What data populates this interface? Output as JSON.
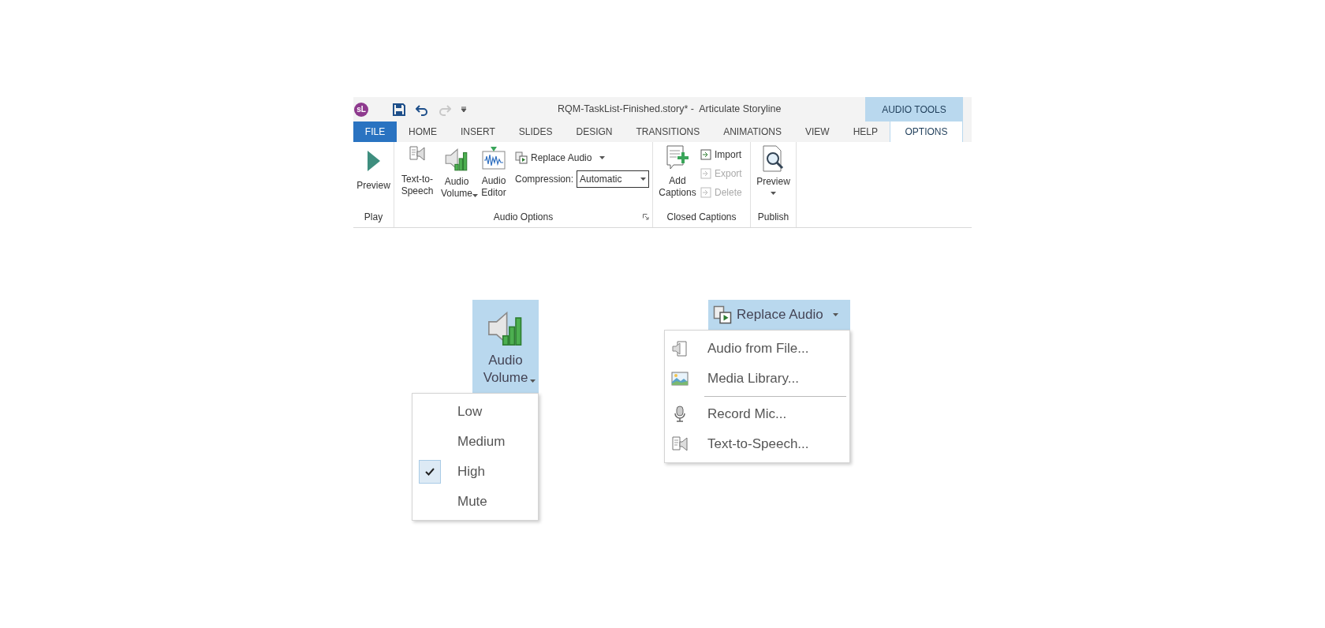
{
  "app_icon": "sL",
  "window_title": "RQM-TaskList-Finished.story* -  Articulate Storyline",
  "contextual_group": "AUDIO TOOLS",
  "tabs": [
    {
      "label": "FILE",
      "kind": "file",
      "selected": false
    },
    {
      "label": "HOME",
      "kind": "plain",
      "selected": false
    },
    {
      "label": "INSERT",
      "kind": "plain",
      "selected": false
    },
    {
      "label": "SLIDES",
      "kind": "plain",
      "selected": false
    },
    {
      "label": "DESIGN",
      "kind": "plain",
      "selected": false
    },
    {
      "label": "TRANSITIONS",
      "kind": "plain",
      "selected": false
    },
    {
      "label": "ANIMATIONS",
      "kind": "plain",
      "selected": false
    },
    {
      "label": "VIEW",
      "kind": "plain",
      "selected": false
    },
    {
      "label": "HELP",
      "kind": "plain",
      "selected": false
    },
    {
      "label": "OPTIONS",
      "kind": "contextual",
      "selected": true
    }
  ],
  "ribbon": {
    "play": {
      "label": "Play",
      "preview": "Preview"
    },
    "audio_options": {
      "label": "Audio Options",
      "text_to_speech": "Text-to-Speech",
      "audio_volume": "Audio Volume",
      "audio_editor": "Audio Editor",
      "replace_audio": "Replace Audio",
      "compression_label": "Compression:",
      "compression_value": "Automatic"
    },
    "closed_captions": {
      "label": "Closed Captions",
      "add_captions": "Add Captions",
      "actions": [
        {
          "label": "Import",
          "disabled": false
        },
        {
          "label": "Export",
          "disabled": true
        },
        {
          "label": "Delete",
          "disabled": true
        }
      ]
    },
    "publish": {
      "label": "Publish",
      "preview": "Preview"
    }
  },
  "volume_demo": {
    "button": "Audio Volume",
    "expanded": true,
    "items": [
      {
        "label": "Low",
        "checked": false
      },
      {
        "label": "Medium",
        "checked": false
      },
      {
        "label": "High",
        "checked": true
      },
      {
        "label": "Mute",
        "checked": false
      }
    ]
  },
  "replace_demo": {
    "button": "Replace Audio",
    "expanded": true,
    "items": [
      {
        "label": "Audio from File...",
        "kind": "file",
        "separator_before": false
      },
      {
        "label": "Media Library...",
        "kind": "library",
        "separator_before": false
      },
      {
        "label": "Record Mic...",
        "kind": "mic",
        "separator_before": true
      },
      {
        "label": "Text-to-Speech...",
        "kind": "tts",
        "separator_before": false
      }
    ]
  }
}
